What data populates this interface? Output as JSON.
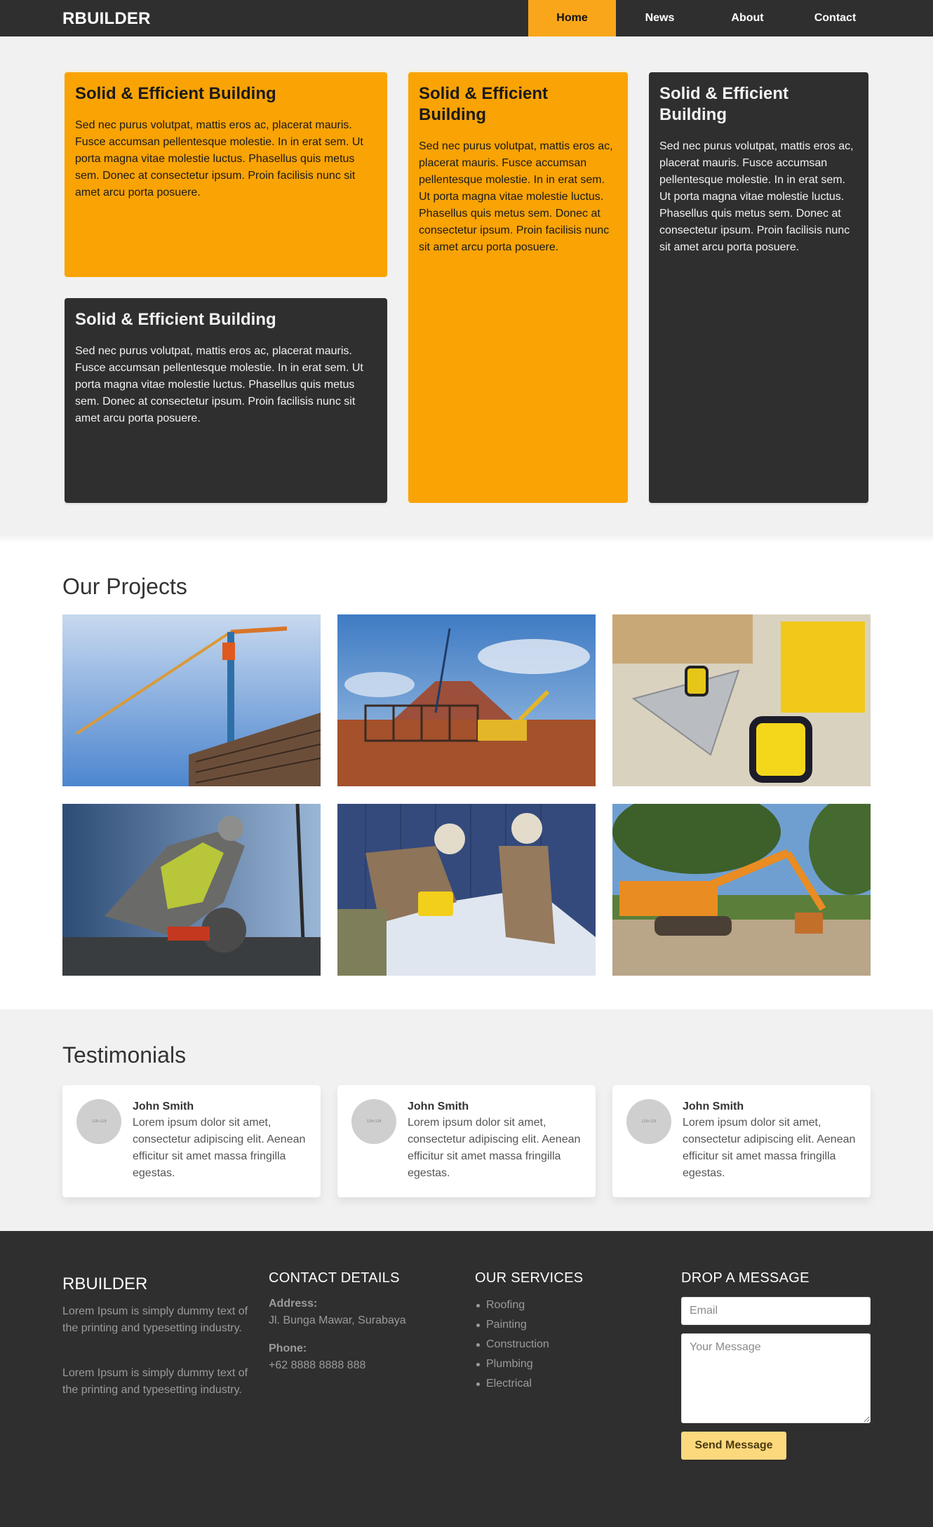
{
  "nav": {
    "brand": "RBUILDER",
    "items": [
      {
        "label": "Home",
        "active": true
      },
      {
        "label": "News",
        "active": false
      },
      {
        "label": "About",
        "active": false
      },
      {
        "label": "Contact",
        "active": false
      }
    ]
  },
  "features": {
    "cards": [
      {
        "title": "Solid & Efficient Building",
        "body": "Sed nec purus volutpat, mattis eros ac, placerat mauris. Fusce accumsan pellentesque molestie. In in erat sem. Ut porta magna vitae molestie luctus. Phasellus quis metus sem. Donec at consectetur ipsum. Proin facilisis nunc sit amet arcu porta posuere.",
        "theme": "yellow"
      },
      {
        "title": "Solid & Efficient Building",
        "body": "Sed nec purus volutpat, mattis eros ac, placerat mauris. Fusce accumsan pellentesque molestie. In in erat sem. Ut porta magna vitae molestie luctus. Phasellus quis metus sem. Donec at consectetur ipsum. Proin facilisis nunc sit amet arcu porta posuere.",
        "theme": "yellow"
      },
      {
        "title": "Solid & Efficient Building",
        "body": "Sed nec purus volutpat, mattis eros ac, placerat mauris. Fusce accumsan pellentesque molestie. In in erat sem. Ut porta magna vitae molestie luctus. Phasellus quis metus sem. Donec at consectetur ipsum. Proin facilisis nunc sit amet arcu porta posuere.",
        "theme": "dark"
      },
      {
        "title": "Solid & Efficient Building",
        "body": "Sed nec purus volutpat, mattis eros ac, placerat mauris. Fusce accumsan pellentesque molestie. In in erat sem. Ut porta magna vitae molestie luctus. Phasellus quis metus sem. Donec at consectetur ipsum. Proin facilisis nunc sit amet arcu porta posuere.",
        "theme": "dark"
      }
    ]
  },
  "projects": {
    "title": "Our Projects",
    "photos": [
      {
        "subject": "tower crane over building"
      },
      {
        "subject": "excavator at steel frame site"
      },
      {
        "subject": "tape measure and speed square on lumber"
      },
      {
        "subject": "worker cutting concrete with saw"
      },
      {
        "subject": "workers cutting corrugated sheet"
      },
      {
        "subject": "orange excavator in yard"
      }
    ]
  },
  "testimonials": {
    "title": "Testimonials",
    "items": [
      {
        "avatar_text": "128×128",
        "name": "John Smith",
        "text": "Lorem ipsum dolor sit amet, consectetur adipiscing elit. Aenean efficitur sit amet massa fringilla egestas."
      },
      {
        "avatar_text": "128×128",
        "name": "John Smith",
        "text": "Lorem ipsum dolor sit amet, consectetur adipiscing elit. Aenean efficitur sit amet massa fringilla egestas."
      },
      {
        "avatar_text": "128×128",
        "name": "John Smith",
        "text": "Lorem ipsum dolor sit amet, consectetur adipiscing elit. Aenean efficitur sit amet massa fringilla egestas."
      }
    ]
  },
  "footer": {
    "brand": "RBUILDER",
    "about": [
      "Lorem Ipsum is simply dummy text of the printing and typesetting industry.",
      "Lorem Ipsum is simply dummy text of the printing and typesetting industry."
    ],
    "contact": {
      "title": "CONTACT DETAILS",
      "address_label": "Address:",
      "address": "Jl. Bunga Mawar, Surabaya",
      "phone_label": "Phone:",
      "phone": "+62 8888 8888 888"
    },
    "services": {
      "title": "OUR SERVICES",
      "items": [
        "Roofing",
        "Painting",
        "Construction",
        "Plumbing",
        "Electrical"
      ]
    },
    "message": {
      "title": "DROP A MESSAGE",
      "email_placeholder": "Email",
      "email_value": "",
      "message_placeholder": "Your Message",
      "message_value": "",
      "send_label": "Send Message"
    }
  },
  "colors": {
    "accent": "#f9a305",
    "nav_active": "#f9a61a",
    "dark": "#2f2f2f",
    "button": "#fdd97d"
  }
}
